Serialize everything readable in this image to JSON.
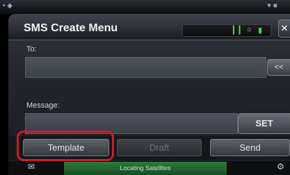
{
  "status_bar": {
    "left_icons": "• ◆",
    "right_icons": "♥ ■"
  },
  "header": {
    "title": "SMS Create Menu",
    "indicators": {
      "signal": "▎▎",
      "link": "○",
      "battery": "▮"
    },
    "close_glyph": "✕"
  },
  "form": {
    "to_label": "To:",
    "to_value": "",
    "back_label": "<<",
    "message_label": "Message:",
    "message_value": "",
    "set_label": "SET"
  },
  "buttons": {
    "template": "Template",
    "draft": "Draft",
    "send": "Send"
  },
  "bottom": {
    "status": "Locating Satellites",
    "left_icon": "✉",
    "right_icon": "⚙"
  },
  "colors": {
    "highlight": "#d11a24",
    "status_green": "#2f7b3b",
    "indicator_green": "#3fd14b"
  }
}
